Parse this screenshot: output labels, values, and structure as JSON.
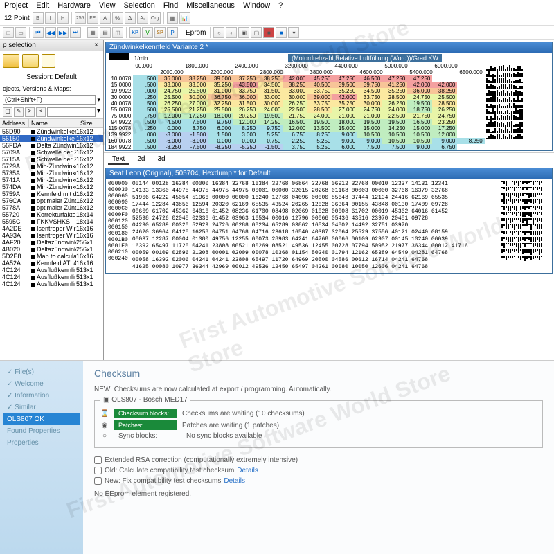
{
  "menu": [
    "Project",
    "Edit",
    "Hardware",
    "View",
    "Selection",
    "Find",
    "Miscellaneous",
    "Window",
    "?"
  ],
  "toolbar_point": "12 Point",
  "toolbar_eprom": "Eprom",
  "left": {
    "title": "p selection",
    "session": "Session: Default",
    "dropdown_label": "ojects, Versions & Maps:",
    "dropdown_value": "(Ctrl+Shift+F)",
    "headers": [
      "Address",
      "Name",
      "Size"
    ],
    "rows": [
      {
        "addr": "56D90",
        "name": "Zündwinkelken",
        "size": "16x12",
        "sel": false
      },
      {
        "addr": "56150",
        "name": "Zündwinkelke",
        "size": "16x12",
        "sel": true
      },
      {
        "addr": "56FDA",
        "name": "Delta Zündwink",
        "size": "16x12",
        "sel": false
      },
      {
        "addr": "5709A",
        "name": "Schwelle der Z",
        "size": "16x12",
        "sel": false
      },
      {
        "addr": "5715A",
        "name": "Schwelle der Z",
        "size": "16x12",
        "sel": false
      },
      {
        "addr": "5729A",
        "name": "Min-Zündwinke",
        "size": "16x12",
        "sel": false
      },
      {
        "addr": "5735A",
        "name": "Min-Zündwinke",
        "size": "16x12",
        "sel": false
      },
      {
        "addr": "5741A",
        "name": "Min-Zündwinke",
        "size": "16x12",
        "sel": false
      },
      {
        "addr": "574DA",
        "name": "Min-Zündwinke",
        "size": "16x12",
        "sel": false
      },
      {
        "addr": "5759A",
        "name": "Kennfeld mit d",
        "size": "16x12",
        "sel": false
      },
      {
        "addr": "576CA",
        "name": "optimaler Zünd",
        "size": "16x12",
        "sel": false
      },
      {
        "addr": "5778A",
        "name": "optimaler Zünd",
        "size": "16x12",
        "sel": false
      },
      {
        "addr": "55720",
        "name": "Korrekturfakto",
        "size": "18x14",
        "sel": false
      },
      {
        "addr": "5595C",
        "name": "FKKVSHKS",
        "size": "18x14",
        "sel": false
      },
      {
        "addr": "4A2DE",
        "name": "Isentroper Wirl",
        "size": "16x16",
        "sel": false
      },
      {
        "addr": "4A93A",
        "name": "Isentroper Wirl",
        "size": "16x16",
        "sel": false
      },
      {
        "addr": "4AF20",
        "name": "Deltazündwink",
        "size": "256x1",
        "sel": false
      },
      {
        "addr": "4B020",
        "name": "Deltazündwink",
        "size": "256x1",
        "sel": false
      },
      {
        "addr": "5D2E8",
        "name": "Map to calculat",
        "size": "16x16",
        "sel": false
      },
      {
        "addr": "4A52A",
        "name": "Kennfeld ATL4",
        "size": "16x16",
        "sel": false
      },
      {
        "addr": "4C124",
        "name": "Ausflußkennlin",
        "size": "513x1",
        "sel": false
      },
      {
        "addr": "4C124",
        "name": "Ausflußkennlin",
        "size": "513x1",
        "sel": false
      },
      {
        "addr": "4C124",
        "name": "Ausflußkennlin",
        "size": "513x1",
        "sel": false
      }
    ]
  },
  "map": {
    "title": "Zündwinkelkennfeld Variante 2 *",
    "header_label": "(Motordrehzahl,Relative Luftfüllung (Word))/Grad KW",
    "unit": "1/min",
    "col_top": [
      "00.000",
      "1800.000",
      "2400.000",
      "3200.000",
      "4400.000",
      "5000.000",
      "6000.000"
    ],
    "col_bot": [
      "2000.000",
      "2200.000",
      "2800.000",
      "3800.000",
      "4600.000",
      "5400.000",
      "6500.000"
    ],
    "rows": [
      {
        "h": "10.0078",
        "v": [
          ".500",
          "36.000",
          "38.250",
          "39.000",
          "37.250",
          "38.250",
          "42.000",
          "45.250",
          "47.250",
          "46.500",
          "47.250",
          "47.250"
        ]
      },
      {
        "h": "15.0000",
        "v": [
          ".500",
          "33.000",
          "33.000",
          "35.250",
          "43.500",
          "34.500",
          "38.250",
          "40.500",
          "39.500",
          "39.750",
          "41.250",
          "42.000",
          "42.000"
        ]
      },
      {
        "h": "19.9922",
        "v": [
          ".000",
          "24.750",
          "25.500",
          "31.000",
          "33.750",
          "31.500",
          "33.000",
          "33.750",
          "35.250",
          "34.500",
          "35.250",
          "36.000",
          "38.250"
        ]
      },
      {
        "h": "30.0000",
        "v": [
          ".250",
          "25.500",
          "30.000",
          "36.750",
          "36.000",
          "33.000",
          "30.000",
          "39.000",
          "42.000",
          "33.750",
          "28.500",
          "24.750",
          "25.500"
        ]
      },
      {
        "h": "40.0078",
        "v": [
          ".500",
          "26.250",
          "27.000",
          "32.250",
          "31.500",
          "30.000",
          "26.250",
          "33.750",
          "35.250",
          "30.000",
          "26.250",
          "19.500",
          "28.500"
        ]
      },
      {
        "h": "55.0078",
        "v": [
          ".500",
          "25.500",
          "21.250",
          "25.500",
          "26.250",
          "24.000",
          "22.500",
          "28.500",
          "27.000",
          "24.750",
          "24.000",
          "18.750",
          "26.250"
        ]
      },
      {
        "h": "75.0000",
        "v": [
          ".750",
          "12.000",
          "17.250",
          "18.000",
          "20.250",
          "19.500",
          "21.750",
          "24.000",
          "21.000",
          "21.000",
          "22.500",
          "21.750",
          "24.750"
        ]
      },
      {
        "h": "94.9922",
        "v": [
          ".500",
          "4.500",
          "7.500",
          "9.750",
          "12.000",
          "14.250",
          "16.500",
          "19.500",
          "18.000",
          "19.500",
          "19.500",
          "16.500",
          "23.250"
        ]
      },
      {
        "h": "115.0078",
        "v": [
          ".250",
          "0.000",
          "3.750",
          "6.000",
          "8.250",
          "9.750",
          "12.000",
          "13.500",
          "15.000",
          "15.000",
          "14.250",
          "15.000",
          "17.250"
        ]
      },
      {
        "h": "139.9922",
        "v": [
          ".000",
          "-3.000",
          "-1.500",
          "1.500",
          "3.000",
          "5.250",
          "6.750",
          "8.250",
          "9.000",
          "10.500",
          "10.500",
          "10.500",
          "12.000"
        ]
      },
      {
        "h": "160.0078",
        "v": [
          ".500",
          "-6.000",
          "-3.000",
          "0.000",
          "0.000",
          "0.750",
          "2.250",
          "5.250",
          "9.000",
          "9.000",
          "10.500",
          "10.500",
          "9.000",
          "8.250"
        ]
      },
      {
        "h": "184.9922",
        "v": [
          ".500",
          "-8.250",
          "-7.500",
          "-8.250",
          "-5.250",
          "-1.500",
          "3.750",
          "5.250",
          "6.000",
          "7.500",
          "7.500",
          "9.000",
          "6.750"
        ]
      }
    ]
  },
  "map_tabs": [
    "Text",
    "2d",
    "3d"
  ],
  "hex": {
    "title": "Seat Leon (Original), 505704, Hexdump * for Default",
    "addrs": [
      "000000",
      "000030",
      "000060",
      "000090",
      "0000C0",
      "0000F0",
      "000120",
      "000150",
      "000180",
      "0001B0",
      "0001E0",
      "000210",
      "000240"
    ],
    "lines": [
      "00144 00128 16384 00000 16384 32768 16384 32768 06864 32768 06912 32768 00010 12337 14131 12341",
      "14133 13360 44975 44975 44975 44975 00001 00000 32015 20268 01168 00003 00000 32768 16379 32768",
      "51966 64222 45054 51966 00000 00000 16240 12768 04096 00000 55648 37444 12134 24416 62169 65535",
      "17444 12284 43856 12594 20320 62169 65535 43524 20265 12028 36364 00155 43848 00130 17409 09728",
      "00669 61702 45362 64016 61452 08236 61700 08498 02069 01028 00008 61702 00019 45362 64016 61452",
      "52598 24726 02048 02336 61452 03963 16534 00016 12796 00066 05436 43516 23970 20481 09728",
      "04290 65289 00320 52929 24726 00288 08234 65289 03862 16534 04802 14492 32751 03970",
      "24620 36964 04128 16258 04751 64768 04716 23618 16540 40387 32064 25529 37556 40121 02440 08159",
      "00037 12287 00004 01380 49756 12255 00073 28983 64241 64768 00066 00109 02907 00145 10240 00039",
      "16392 65497 11720 04241 23808 00521 00269 08521 49536 12455 00728 07794 50952 21977 36344 00012 41716",
      "00059 00109 02896 21308 00001 02009 00078 10368 01154 50240 01794 12162 65389 64549 04281 64768",
      "00058 16392 02006 04241 04241 23808 65497 11720 64969 20500 04586 00612 16714 04241 64768",
      "41625 00080 10977 36344 42969 00012 49536 12450 65497 04261 00080 10050 12606 04241 64768"
    ]
  },
  "checksum": {
    "title": "Checksum",
    "new_notice": "NEW: Checksums are now calculated at export / programming. Automatically.",
    "box_label": "OLS807 - Bosch MED17",
    "rows": [
      {
        "icon": "⌛",
        "label": "Checksum blocks:",
        "text": "Checksums are waiting (10 checksums)"
      },
      {
        "icon": "◉",
        "label": "Patches:",
        "text": "Patches are waiting (1 patches)"
      },
      {
        "icon": "○",
        "label": "    Sync blocks:",
        "text": "No sync blocks available",
        "plain": true
      }
    ],
    "checks": [
      {
        "label": "Extended RSA correction (computationally extremely intensive)"
      },
      {
        "label": "Old: Calculate compatibility test checksum",
        "details": "Details"
      },
      {
        "label": "New: Fix compatibility test checksums",
        "details": "Details"
      }
    ],
    "footer": "No EEprom element registered.",
    "nav": [
      "File(s)",
      "Welcome",
      "Information",
      "Similar",
      "OLS807 OK",
      "Found Properties",
      "Properties"
    ],
    "nav_sel": 4
  }
}
